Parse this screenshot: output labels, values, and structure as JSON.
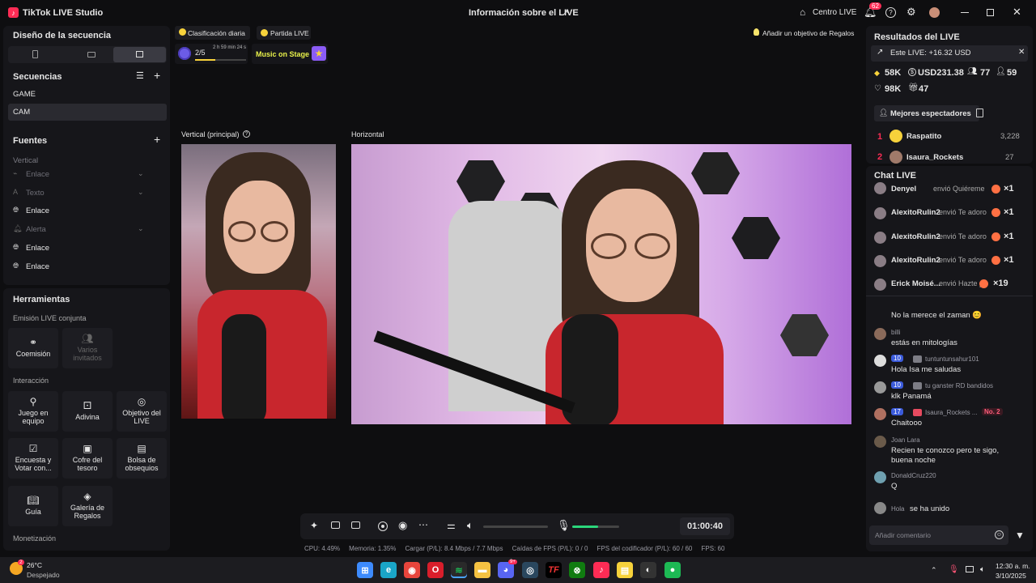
{
  "app": {
    "name": "TikTok LIVE Studio",
    "center_title": "Información sobre el LIVE",
    "centro_live": "Centro LIVE",
    "notif_count": "62"
  },
  "left": {
    "design_title": "Diseño de la secuencia",
    "sequences_title": "Secuencias",
    "sequences": [
      "GAME",
      "CAM"
    ],
    "sources_title": "Fuentes",
    "vertical_label": "Vertical",
    "sources": [
      {
        "label": "Enlace",
        "dim": true,
        "icon": "link-icon"
      },
      {
        "label": "Texto",
        "dim": true,
        "icon": "text-icon"
      },
      {
        "label": "Enlace",
        "dim": false,
        "icon": "globe-icon"
      },
      {
        "label": "Alerta",
        "dim": true,
        "icon": "bell-icon"
      },
      {
        "label": "Enlace",
        "dim": false,
        "icon": "globe-icon"
      },
      {
        "label": "Enlace",
        "dim": false,
        "icon": "globe-icon"
      }
    ],
    "tools_title": "Herramientas",
    "joint_title": "Emisión LIVE conjunta",
    "coemision": "Coemisión",
    "varios": "Varios invitados",
    "interaction_title": "Interacción",
    "tools": [
      "Juego en equipo",
      "Adivina",
      "Objetivo del LIVE",
      "Encuesta y Votar con...",
      "Cofre del tesoro",
      "Bolsa de obsequios",
      "Guía",
      "Galería de Regalos"
    ],
    "monet_title": "Monetización"
  },
  "top": {
    "daily_rank": "Clasificación diaria",
    "partida": "Partida LIVE",
    "add_goal": "Añadir un objetivo de Regalos",
    "progress": "2/5",
    "progress_time": "2 h 59 min 24 s",
    "progress_fill": 0.4,
    "music": "Music on Stage"
  },
  "preview": {
    "vertical_label": "Vertical (principal)",
    "horizontal_label": "Horizontal"
  },
  "controls": {
    "timer": "01:00:40",
    "volume_fill": 0.0,
    "mic_fill": 0.55
  },
  "stats": {
    "cpu": "CPU:  4.49%",
    "mem": "Memoria:  1.35%",
    "load": "Cargar (P/L):  8.4 Mbps / 7.7 Mbps",
    "drops": "Caídas de FPS (P/L):  0 / 0",
    "enc": "FPS del codificador (P/L):  60 / 60",
    "fps": "FPS:  60"
  },
  "results": {
    "title": "Resultados del LIVE",
    "este": "Este LIVE: +16.32 USD",
    "diamonds": "58K",
    "usd": "USD231.38",
    "viewers": "77",
    "new": "59",
    "likes": "98K",
    "gifts": "47",
    "best_tab": "Mejores espectadores",
    "top1_rank": "1",
    "top1_name": "Raspatito",
    "top1_score": "3,228",
    "top2_rank": "2",
    "top2_name": "Isaura_Rockets",
    "top2_score": "27"
  },
  "chat": {
    "title": "Chat LIVE",
    "gifts": [
      {
        "user": "Denyel",
        "verb": "envió Quiéreme",
        "count": "×1"
      },
      {
        "user": "AlexitoRulin2",
        "verb": "envió Te adoro",
        "count": "×1"
      },
      {
        "user": "AlexitoRulin2",
        "verb": "envió Te adoro",
        "count": "×1"
      },
      {
        "user": "AlexitoRulin2",
        "verb": "envió Te adoro",
        "count": "×1"
      },
      {
        "user": "Erick Moisé...",
        "verb": "envió Hazte p",
        "count": "×19"
      }
    ],
    "messages": [
      {
        "user": "",
        "text": "No la merece el zaman 😊"
      },
      {
        "user": "billi",
        "text": "estás en mitologías"
      },
      {
        "user": "tuntuntunsahur101",
        "lvl": "10",
        "text": "Hola Isa me saludas"
      },
      {
        "user": "tu ganster RD bandidos",
        "lvl": "10",
        "text": "klk Panamá"
      },
      {
        "user": "Isaura_Rockets ...",
        "lvl": "17",
        "badge": "No. 2",
        "text": "Chaitooo"
      },
      {
        "user": "Joan Lara",
        "text": "Recien te conozco pero te sigo, buena noche"
      },
      {
        "user": "DonaldCruz220",
        "text": "Q"
      },
      {
        "user": "Hola",
        "text": "se ha unido"
      }
    ],
    "placeholder": "Añadir comentario"
  },
  "taskbar": {
    "temp": "26°C",
    "weather": "Despejado",
    "time": "12:30 a. m.",
    "date": "3/10/2025",
    "weather_badge": "2",
    "discord_badge": "9+"
  },
  "colors": {
    "accent": "#fe2c55",
    "green": "#2bd67b",
    "yellow": "#f7d23b",
    "panel": "#16161a"
  }
}
